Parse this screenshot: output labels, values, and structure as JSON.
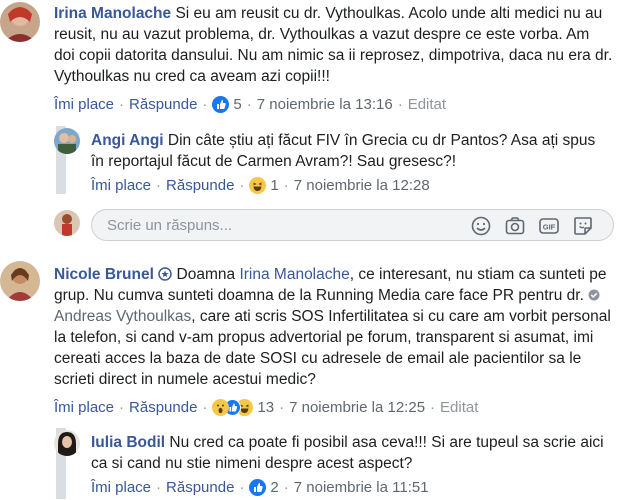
{
  "actions_labels": {
    "like": "Îmi place",
    "reply": "Răspunde"
  },
  "comments": [
    {
      "author": "Irina Manolache",
      "text": "Si eu am reusit cu dr. Vythoulkas. Acolo unde alti medici nu au reusit, nu au vazut problema, dr. Vythoulkas a vazut despre ce este vorba. Am doi copii datorita dansului. Nu am nimic sa ii reprosez, dimpotriva, daca nu era dr. Vythoulkas nu cred ca aveam azi copii!!!",
      "reaction_count": "5",
      "timestamp": "7 noiembrie la 13:16",
      "edited": "Editat"
    },
    {
      "author": "Angi Angi",
      "text": "Din câte știu ați făcut FIV în Grecia cu dr Pantos? Asa ați spus în reportajul făcut de Carmen Avram?! Sau gresesc?!",
      "reaction_count": "1",
      "timestamp": "7 noiembrie la 12:28"
    },
    {
      "author": "Nicole Brunel",
      "text_1": "Doamna",
      "mention_1": "Irina Manolache",
      "text_2": ", ce interesant, nu stiam ca sunteti pe grup. Nu cumva sunteti doamna de la Running Media care face PR pentru dr.",
      "mention_2": "Andreas Vythoulkas",
      "text_3": ", care ati scris SOS Infertilitatea si cu care am vorbit personal la telefon, si cand v-am propus advertorial pe forum, transparent si asumat, imi cereati acces la baza de date SOSI cu adresele de email ale pacientilor sa le scrieti direct in numele acestui medic?",
      "reaction_count": "13",
      "timestamp": "7 noiembrie la 12:25",
      "edited": "Editat"
    },
    {
      "author": "Iulia Bodil",
      "text": "Nu cred ca poate fi posibil asa ceva!!! Si are tupeul sa scrie aici ca si cand nu stie nimeni despre acest aspect?",
      "reaction_count": "2",
      "timestamp": "7 noiembrie la 11:51"
    }
  ],
  "reply_input": {
    "placeholder": "Scrie un răspuns..."
  },
  "icons": {
    "reply_input": [
      "emoji-icon",
      "camera-icon",
      "gif-icon",
      "sticker-icon"
    ],
    "reactions": [
      "like-icon",
      "haha-icon",
      "wow-icon"
    ]
  },
  "colors": {
    "link": "#385898",
    "meta": "#606770",
    "like_blue": "#1877f2",
    "emoji_yellow": "#f7c847"
  }
}
